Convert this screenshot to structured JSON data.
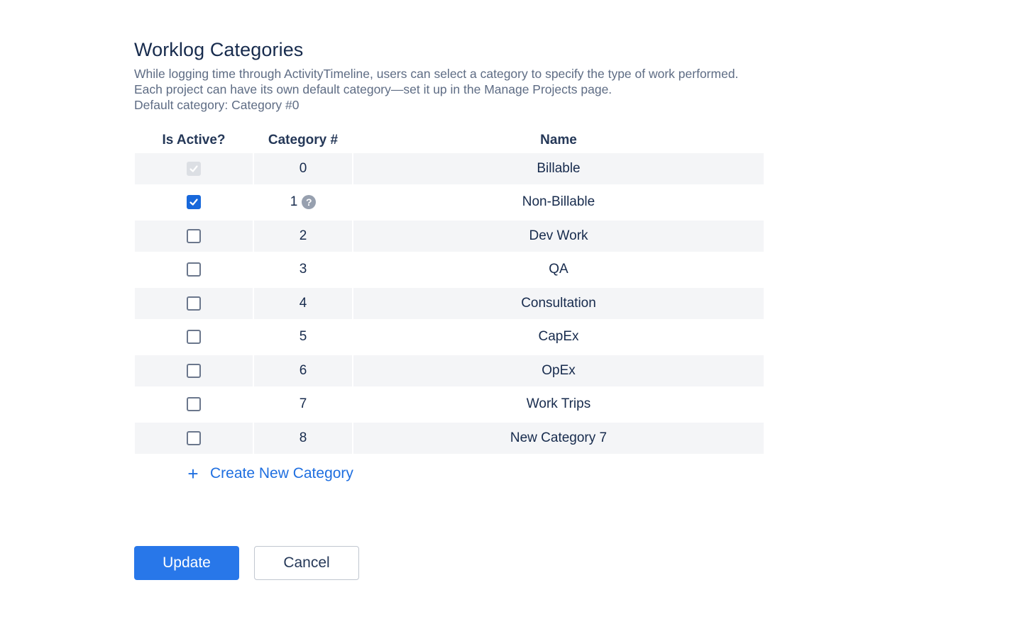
{
  "header": {
    "title": "Worklog Categories",
    "description_line1": "While logging time through ActivityTimeline, users can select a category to specify the type of work performed.",
    "description_line2": "Each project can have its own default category—set it up in the Manage Projects page.",
    "default_category": "Default category: Category #0"
  },
  "table": {
    "columns": {
      "active": "Is Active?",
      "number": "Category #",
      "name": "Name"
    },
    "rows": [
      {
        "active": true,
        "disabled": true,
        "number": "0",
        "name": "Billable",
        "help": false
      },
      {
        "active": true,
        "disabled": false,
        "number": "1",
        "name": "Non-Billable",
        "help": true
      },
      {
        "active": false,
        "disabled": false,
        "number": "2",
        "name": "Dev Work",
        "help": false
      },
      {
        "active": false,
        "disabled": false,
        "number": "3",
        "name": "QA",
        "help": false
      },
      {
        "active": false,
        "disabled": false,
        "number": "4",
        "name": "Consultation",
        "help": false
      },
      {
        "active": false,
        "disabled": false,
        "number": "5",
        "name": "CapEx",
        "help": false
      },
      {
        "active": false,
        "disabled": false,
        "number": "6",
        "name": "OpEx",
        "help": false
      },
      {
        "active": false,
        "disabled": false,
        "number": "7",
        "name": "Work Trips",
        "help": false
      },
      {
        "active": false,
        "disabled": false,
        "number": "8",
        "name": "New Category 7",
        "help": false
      }
    ]
  },
  "create_link": {
    "icon": "plus-icon",
    "label": "Create New Category"
  },
  "actions": {
    "update_label": "Update",
    "cancel_label": "Cancel"
  },
  "colors": {
    "primary": "#2877e9",
    "link": "#1f6fe0",
    "row_shade": "#f4f5f7",
    "title": "#172b4d"
  }
}
